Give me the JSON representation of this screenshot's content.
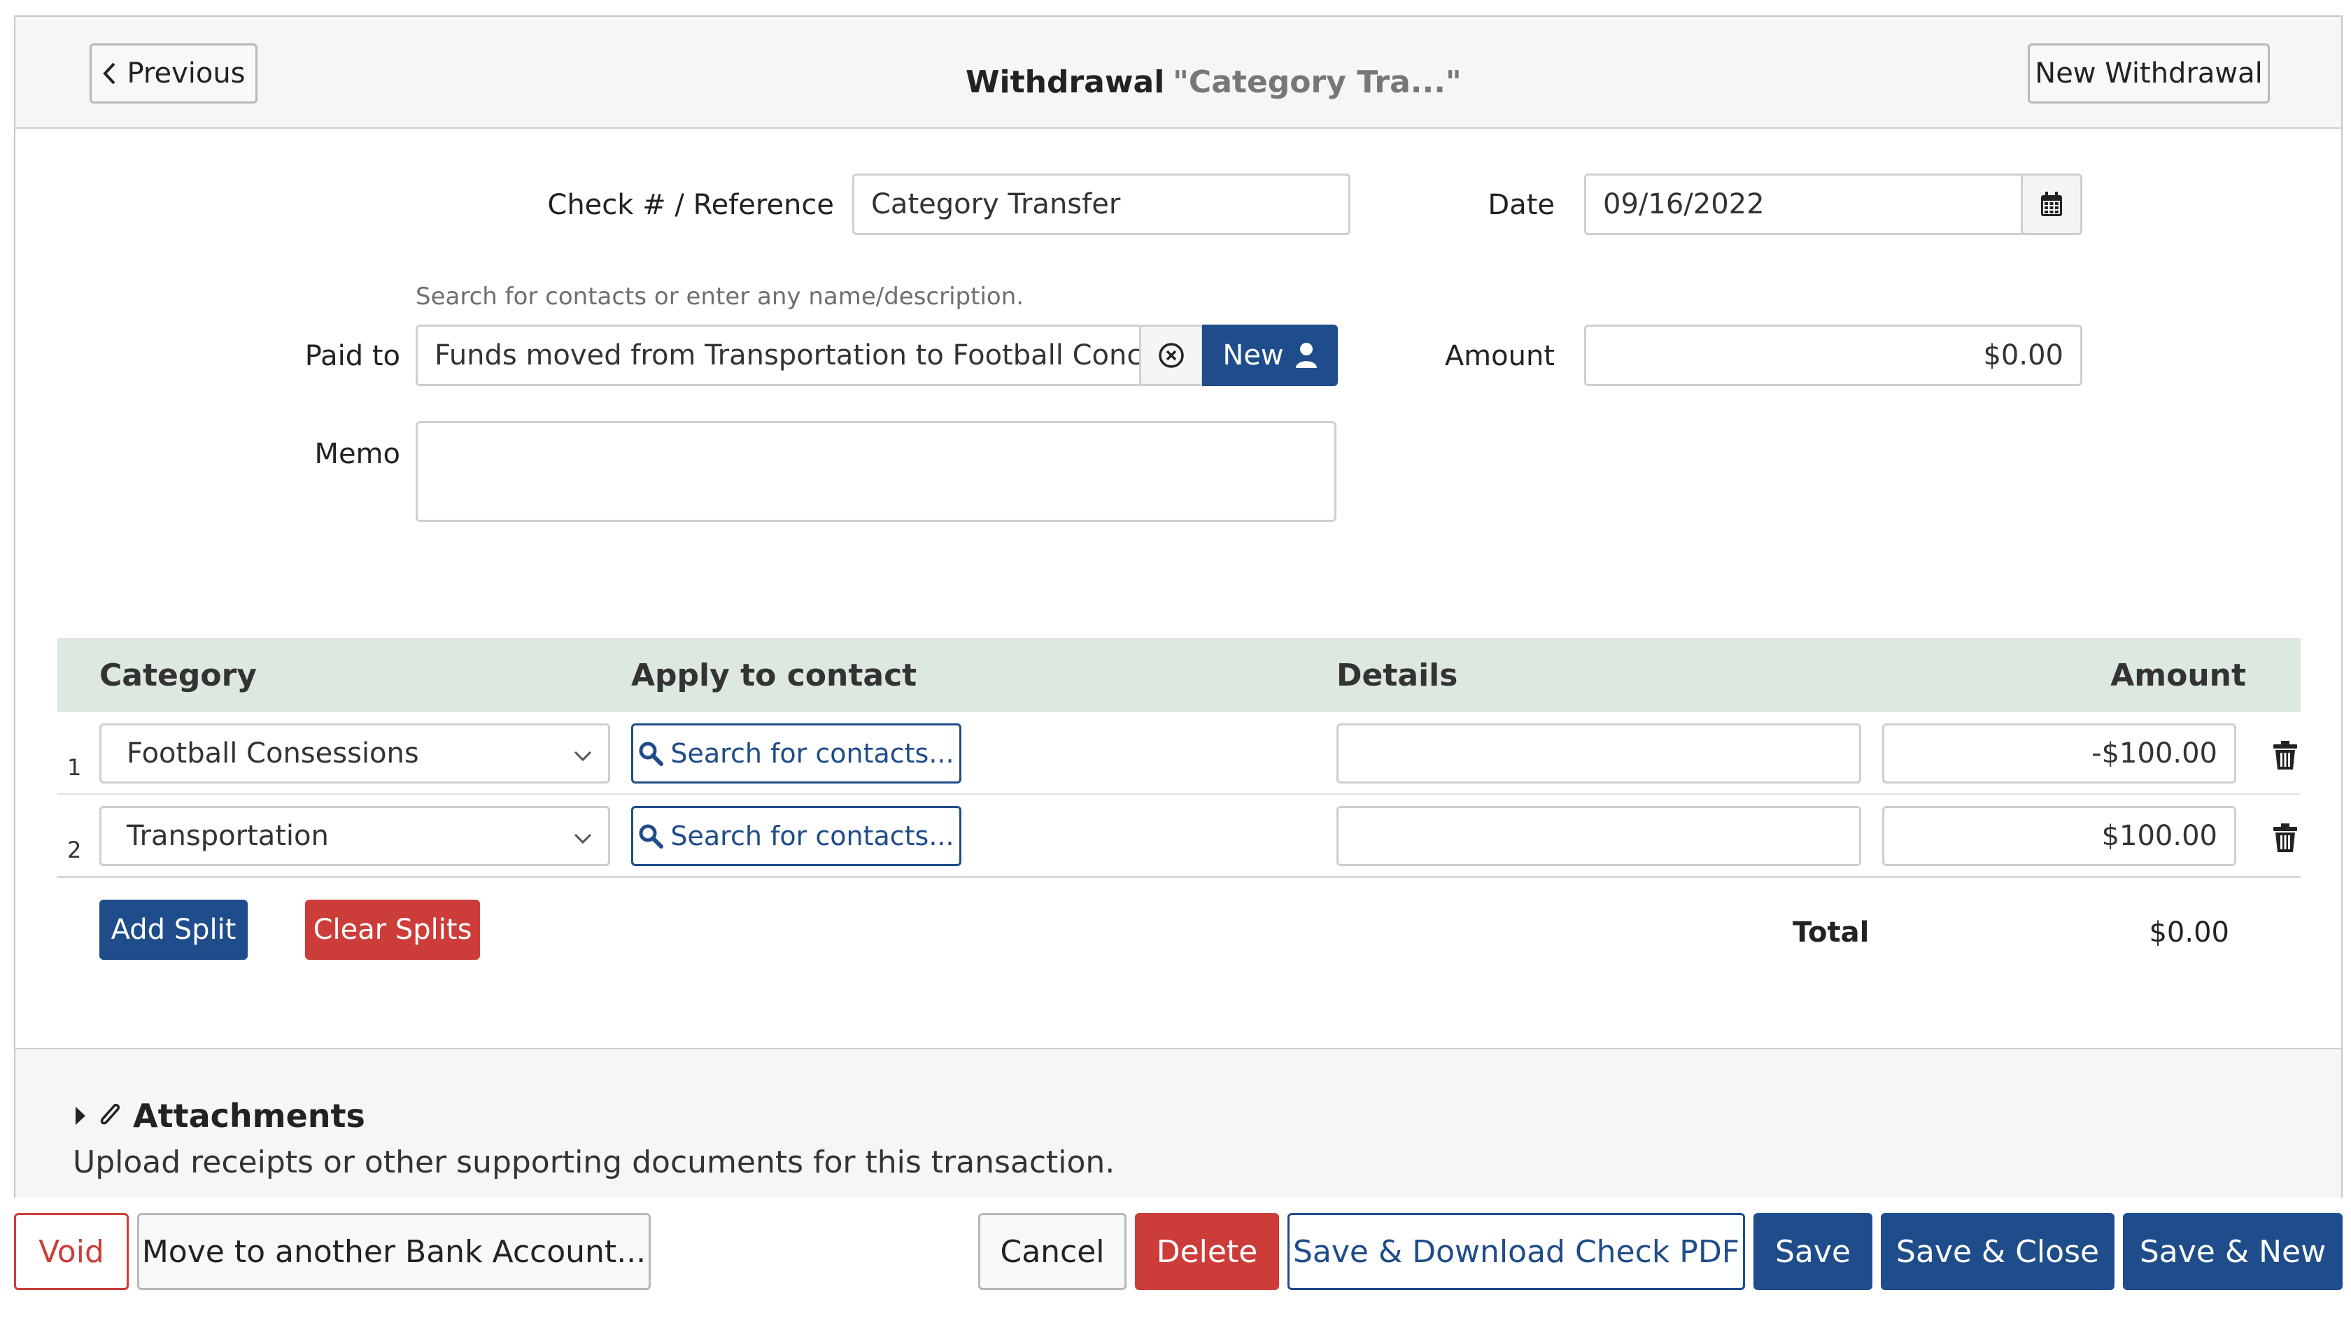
{
  "header": {
    "previous_label": "Previous",
    "title": "Withdrawal",
    "subtitle": "\"Category Tra...\"",
    "new_label": "New Withdrawal"
  },
  "form": {
    "check_label": "Check # / Reference",
    "check_value": "Category Transfer",
    "date_label": "Date",
    "date_value": "09/16/2022",
    "paid_to_help": "Search for contacts or enter any name/description.",
    "paid_to_label": "Paid to",
    "paid_to_value": "Funds moved from Transportation to Football Concess",
    "new_contact_label": "New",
    "amount_label": "Amount",
    "amount_value": "$0.00",
    "memo_label": "Memo",
    "memo_value": ""
  },
  "splits": {
    "columns": {
      "category": "Category",
      "apply": "Apply to contact",
      "details": "Details",
      "amount": "Amount"
    },
    "rows": [
      {
        "num": "1",
        "category": "Football Consessions",
        "contact_button": "Search for contacts...",
        "details": "",
        "amount": "-$100.00"
      },
      {
        "num": "2",
        "category": "Transportation",
        "contact_button": "Search for contacts...",
        "details": "",
        "amount": "$100.00"
      }
    ],
    "add_label": "Add Split",
    "clear_label": "Clear Splits",
    "total_label": "Total",
    "total_value": "$0.00"
  },
  "attachments": {
    "title": "Attachments",
    "description": "Upload receipts or other supporting documents for this transaction."
  },
  "actions": {
    "void": "Void",
    "move": "Move to another Bank Account...",
    "cancel": "Cancel",
    "delete": "Delete",
    "save_pdf": "Save & Download Check PDF",
    "save": "Save",
    "save_close": "Save & Close",
    "save_new": "Save & New"
  },
  "colors": {
    "navy": "#1f4c8a",
    "red": "#cc3d3a",
    "table_header_bg": "#dde8df"
  }
}
